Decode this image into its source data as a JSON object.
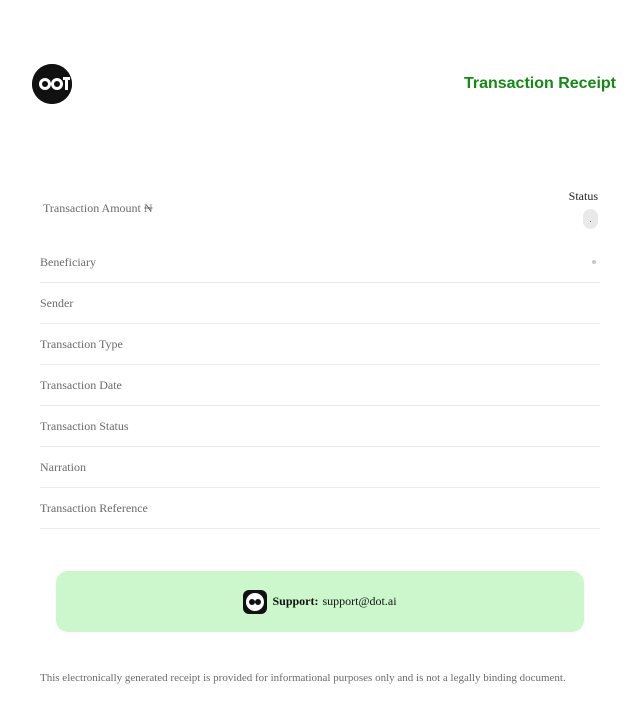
{
  "header": {
    "logo_text": "DOT",
    "title": "Transaction Receipt",
    "accent_color": "#148a14"
  },
  "amount": {
    "label": "Transaction Amount ₦"
  },
  "status": {
    "label": "Status",
    "value": "."
  },
  "details": {
    "rows": [
      {
        "label": "Beneficiary"
      },
      {
        "label": "Sender"
      },
      {
        "label": "Transaction Type"
      },
      {
        "label": "Transaction Date"
      },
      {
        "label": "Transaction Status"
      },
      {
        "label": "Narration"
      },
      {
        "label": "Transaction Reference"
      }
    ]
  },
  "support": {
    "label": "Support:",
    "email": "support@dot.ai",
    "background": "#ccf7cc"
  },
  "footer": {
    "disclaimer": "This electronically generated receipt is provided for informational purposes only and is not a legally binding document."
  }
}
